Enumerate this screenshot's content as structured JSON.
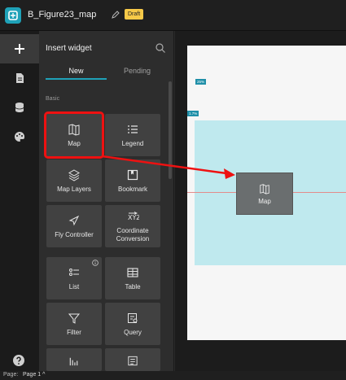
{
  "header": {
    "title": "B_Figure23_map",
    "draft_label": "Draft",
    "logo_icon": "experience-builder-logo",
    "edit_icon": "pencil-icon",
    "accent_color": "#1fa2b8",
    "draft_color": "#f7c948"
  },
  "rail": {
    "items": [
      {
        "icon": "plus-icon",
        "active": true
      },
      {
        "icon": "page-icon",
        "active": false
      },
      {
        "icon": "database-icon",
        "active": false
      },
      {
        "icon": "palette-icon",
        "active": false
      }
    ],
    "help_icon": "help-icon"
  },
  "panel": {
    "title": "Insert widget",
    "tabs": [
      {
        "label": "New",
        "active": true
      },
      {
        "label": "Pending",
        "active": false
      }
    ],
    "section": "Basic",
    "widgets": [
      {
        "label": "Map",
        "icon": "map-icon",
        "selected": true
      },
      {
        "label": "Legend",
        "icon": "legend-icon"
      },
      {
        "label": "Map Layers",
        "icon": "layers-icon"
      },
      {
        "label": "Bookmark",
        "icon": "bookmark-icon"
      },
      {
        "label": "Fly Controller",
        "icon": "fly-icon"
      },
      {
        "label": "Coordinate Conversion",
        "icon": "coordinate-icon"
      },
      {
        "label": "List",
        "icon": "list-icon"
      },
      {
        "label": "Table",
        "icon": "table-icon"
      },
      {
        "label": "Filter",
        "icon": "filter-icon"
      },
      {
        "label": "Query",
        "icon": "query-icon"
      },
      {
        "label": "",
        "icon": "chart-icon"
      },
      {
        "label": "",
        "icon": "text-icon"
      }
    ]
  },
  "canvas": {
    "ruler_tag_1": "25%",
    "ruler_tag_2": "1.7%",
    "ghost_widget_label": "Map",
    "highlight_color": "#e11111"
  },
  "footer": {
    "page_label": "Page:",
    "page_value": "Page 1 ^"
  }
}
